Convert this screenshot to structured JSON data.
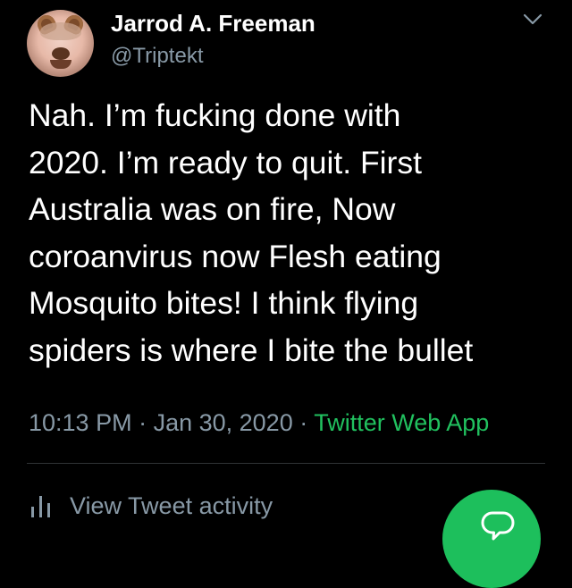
{
  "user": {
    "name": "Jarrod A. Freeman",
    "handle": "@Triptekt"
  },
  "tweet": {
    "lines": [
      "Nah. I’m fucking done with",
      "2020. I’m ready to quit. First",
      "Australia was on fire, Now",
      "coroanvirus now Flesh eating",
      "Mosquito bites! I think flying",
      "spiders is where I bite the bullet"
    ]
  },
  "meta": {
    "time": "10:13 PM",
    "separator": " · ",
    "date": "Jan 30, 2020",
    "source": "Twitter Web App"
  },
  "actions": {
    "view_activity": "View Tweet activity"
  },
  "icons": {
    "more": "chevron-down-icon",
    "activity": "bar-chart-icon",
    "compose_reply": "speech-bubble-icon"
  },
  "colors": {
    "background": "#000000",
    "text": "#ffffff",
    "secondary": "#8899a6",
    "source_link": "#21c15f",
    "fab": "#1dbf5c"
  }
}
